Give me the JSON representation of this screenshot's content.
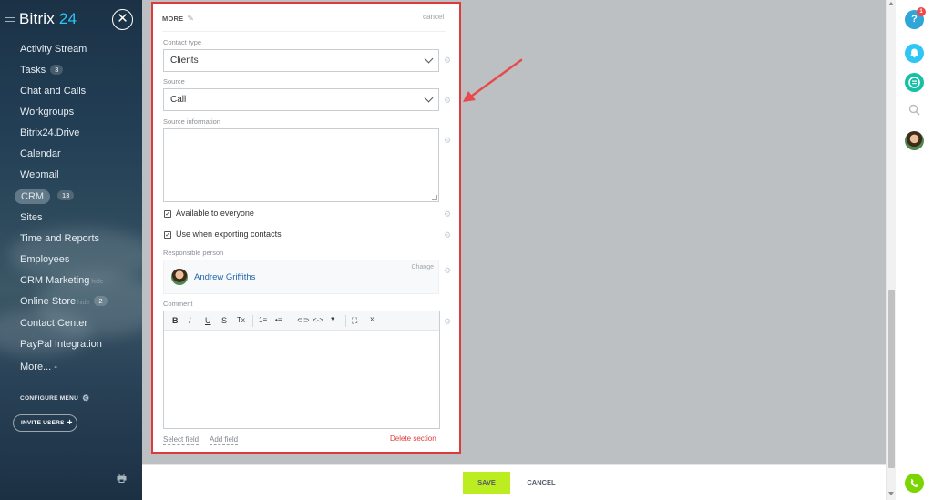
{
  "sidebar": {
    "logo_prefix": "Bitrix",
    "logo_number": "24",
    "close_glyph": "✕",
    "items": [
      {
        "label": "Activity Stream"
      },
      {
        "label": "Tasks",
        "count": "3"
      },
      {
        "label": "Chat and Calls"
      },
      {
        "label": "Workgroups"
      },
      {
        "label": "Bitrix24.Drive"
      },
      {
        "label": "Calendar"
      },
      {
        "label": "Webmail"
      },
      {
        "label": "CRM",
        "count": "13"
      },
      {
        "label": "Sites"
      },
      {
        "label": "Time and Reports"
      },
      {
        "label": "Employees"
      },
      {
        "label": "CRM Marketing",
        "ghost": "hide"
      },
      {
        "label": "Online Store",
        "ghost": "hide",
        "count": "2"
      },
      {
        "label": "Contact Center"
      },
      {
        "label": "PayPal Integration"
      },
      {
        "label": "More... -"
      }
    ],
    "configure_menu": "CONFIGURE MENU",
    "invite_users": "INVITE USERS"
  },
  "form": {
    "section_title": "MORE",
    "cancel_link": "cancel",
    "contact_type": {
      "label": "Contact type",
      "value": "Clients"
    },
    "source": {
      "label": "Source",
      "value": "Call"
    },
    "source_information": {
      "label": "Source information",
      "value": ""
    },
    "available_to_everyone": {
      "label": "Available to everyone",
      "checked": true
    },
    "use_when_exporting": {
      "label": "Use when exporting contacts",
      "checked": true
    },
    "responsible": {
      "label": "Responsible person",
      "name": "Andrew Griffiths",
      "change": "Change"
    },
    "comment": {
      "label": "Comment"
    },
    "toolbar": {
      "bold": "B",
      "italic": "I",
      "underline": "U",
      "strike": "S",
      "clear": "Tx",
      "ordered_list": "1≡",
      "bullet_list": "•≡",
      "link": "⊂⊃",
      "code": "<·>",
      "quote": "❞",
      "fullscreen": "⛶",
      "more": "»"
    },
    "select_field": "Select field",
    "add_field": "Add field",
    "delete_section": "Delete section"
  },
  "footer": {
    "save": "SAVE",
    "cancel": "CANCEL"
  },
  "rightbar": {
    "help_badge": "1",
    "help_glyph": "?"
  },
  "colors": {
    "accent_red": "#e0393b",
    "save_green": "#bbed21",
    "link_blue": "#2067b0",
    "bitrix_blue": "#2fc6f6"
  }
}
